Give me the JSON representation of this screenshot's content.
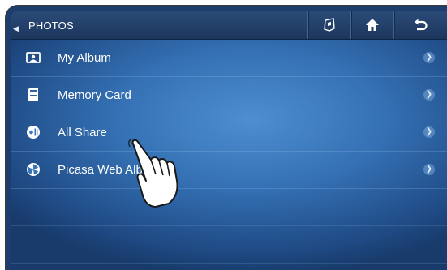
{
  "header": {
    "title": "PHOTOS",
    "buttons": [
      {
        "icon": "slideshow-icon"
      },
      {
        "icon": "home-icon"
      },
      {
        "icon": "return-icon"
      }
    ]
  },
  "menu": {
    "items": [
      {
        "label": "My Album",
        "icon": "album-icon"
      },
      {
        "label": "Memory Card",
        "icon": "memory-card-icon"
      },
      {
        "label": "All Share",
        "icon": "allshare-icon"
      },
      {
        "label": "Picasa Web Album",
        "icon": "picasa-icon"
      }
    ]
  },
  "colors": {
    "title_bar": "#1f3c66",
    "background": "#3470b3"
  }
}
